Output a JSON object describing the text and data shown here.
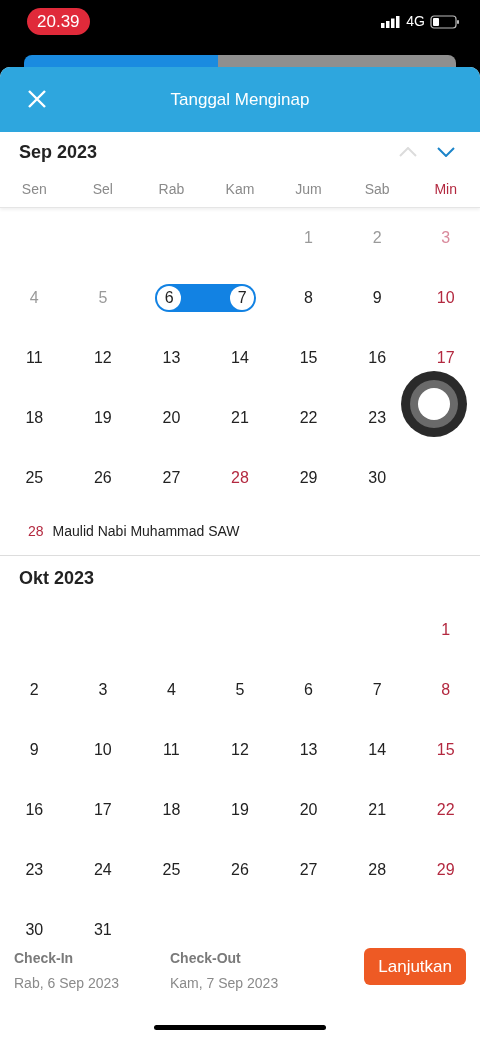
{
  "status_bar": {
    "time": "20.39",
    "network": "4G"
  },
  "header": {
    "title": "Tanggal Menginap"
  },
  "nav": {
    "prev_disabled": true,
    "next_disabled": false
  },
  "weekdays": [
    {
      "label": "Sen",
      "kind": "normal"
    },
    {
      "label": "Sel",
      "kind": "normal"
    },
    {
      "label": "Rab",
      "kind": "normal"
    },
    {
      "label": "Kam",
      "kind": "normal"
    },
    {
      "label": "Jum",
      "kind": "normal"
    },
    {
      "label": "Sab",
      "kind": "normal"
    },
    {
      "label": "Min",
      "kind": "sunday"
    }
  ],
  "months": [
    {
      "title": "Sep 2023",
      "weeks": [
        [
          {
            "kind": "blank"
          },
          {
            "kind": "blank"
          },
          {
            "kind": "blank"
          },
          {
            "kind": "blank"
          },
          {
            "day": "1",
            "kind": "past",
            "selected": false
          },
          {
            "day": "2",
            "kind": "past",
            "selected": false
          },
          {
            "day": "3",
            "kind": "past_holiday",
            "selected": false
          }
        ],
        [
          {
            "day": "4",
            "kind": "past",
            "selected": false
          },
          {
            "day": "5",
            "kind": "past",
            "selected": false
          },
          {
            "day": "6",
            "kind": "normal",
            "selected": true
          },
          {
            "day": "7",
            "kind": "normal",
            "selected": true
          },
          {
            "day": "8",
            "kind": "normal",
            "selected": false
          },
          {
            "day": "9",
            "kind": "normal",
            "selected": false
          },
          {
            "day": "10",
            "kind": "holiday",
            "selected": false
          }
        ],
        [
          {
            "day": "11",
            "kind": "normal",
            "selected": false
          },
          {
            "day": "12",
            "kind": "normal",
            "selected": false
          },
          {
            "day": "13",
            "kind": "normal",
            "selected": false
          },
          {
            "day": "14",
            "kind": "normal",
            "selected": false
          },
          {
            "day": "15",
            "kind": "normal",
            "selected": false
          },
          {
            "day": "16",
            "kind": "normal",
            "selected": false
          },
          {
            "day": "17",
            "kind": "holiday",
            "selected": false
          }
        ],
        [
          {
            "day": "18",
            "kind": "normal",
            "selected": false
          },
          {
            "day": "19",
            "kind": "normal",
            "selected": false
          },
          {
            "day": "20",
            "kind": "normal",
            "selected": false
          },
          {
            "day": "21",
            "kind": "normal",
            "selected": false
          },
          {
            "day": "22",
            "kind": "normal",
            "selected": false
          },
          {
            "day": "23",
            "kind": "normal",
            "selected": false
          },
          {
            "kind": "blank"
          }
        ],
        [
          {
            "day": "25",
            "kind": "normal",
            "selected": false
          },
          {
            "day": "26",
            "kind": "normal",
            "selected": false
          },
          {
            "day": "27",
            "kind": "normal",
            "selected": false
          },
          {
            "day": "28",
            "kind": "holiday",
            "selected": false
          },
          {
            "day": "29",
            "kind": "normal",
            "selected": false
          },
          {
            "day": "30",
            "kind": "normal",
            "selected": false
          },
          {
            "kind": "blank"
          }
        ]
      ],
      "holidays": [
        {
          "day": "28",
          "name": "Maulid Nabi Muhammad SAW"
        }
      ]
    },
    {
      "title": "Okt 2023",
      "weeks": [
        [
          {
            "kind": "blank"
          },
          {
            "kind": "blank"
          },
          {
            "kind": "blank"
          },
          {
            "kind": "blank"
          },
          {
            "kind": "blank"
          },
          {
            "kind": "blank"
          },
          {
            "day": "1",
            "kind": "holiday",
            "selected": false
          }
        ],
        [
          {
            "day": "2",
            "kind": "normal",
            "selected": false
          },
          {
            "day": "3",
            "kind": "normal",
            "selected": false
          },
          {
            "day": "4",
            "kind": "normal",
            "selected": false
          },
          {
            "day": "5",
            "kind": "normal",
            "selected": false
          },
          {
            "day": "6",
            "kind": "normal",
            "selected": false
          },
          {
            "day": "7",
            "kind": "normal",
            "selected": false
          },
          {
            "day": "8",
            "kind": "holiday",
            "selected": false
          }
        ],
        [
          {
            "day": "9",
            "kind": "normal",
            "selected": false
          },
          {
            "day": "10",
            "kind": "normal",
            "selected": false
          },
          {
            "day": "11",
            "kind": "normal",
            "selected": false
          },
          {
            "day": "12",
            "kind": "normal",
            "selected": false
          },
          {
            "day": "13",
            "kind": "normal",
            "selected": false
          },
          {
            "day": "14",
            "kind": "normal",
            "selected": false
          },
          {
            "day": "15",
            "kind": "holiday",
            "selected": false
          }
        ],
        [
          {
            "day": "16",
            "kind": "normal",
            "selected": false
          },
          {
            "day": "17",
            "kind": "normal",
            "selected": false
          },
          {
            "day": "18",
            "kind": "normal",
            "selected": false
          },
          {
            "day": "19",
            "kind": "normal",
            "selected": false
          },
          {
            "day": "20",
            "kind": "normal",
            "selected": false
          },
          {
            "day": "21",
            "kind": "normal",
            "selected": false
          },
          {
            "day": "22",
            "kind": "holiday",
            "selected": false
          }
        ],
        [
          {
            "day": "23",
            "kind": "normal",
            "selected": false
          },
          {
            "day": "24",
            "kind": "normal",
            "selected": false
          },
          {
            "day": "25",
            "kind": "normal",
            "selected": false
          },
          {
            "day": "26",
            "kind": "normal",
            "selected": false
          },
          {
            "day": "27",
            "kind": "normal",
            "selected": false
          },
          {
            "day": "28",
            "kind": "normal",
            "selected": false
          },
          {
            "day": "29",
            "kind": "holiday",
            "selected": false
          }
        ],
        [
          {
            "day": "30",
            "kind": "normal",
            "selected": false
          },
          {
            "day": "31",
            "kind": "normal",
            "selected": false
          },
          {
            "kind": "blank"
          },
          {
            "kind": "blank"
          },
          {
            "kind": "blank"
          },
          {
            "kind": "blank"
          },
          {
            "kind": "blank"
          }
        ]
      ]
    }
  ],
  "footer": {
    "check_in": {
      "label": "Check-In",
      "value": "Rab, 6 Sep 2023"
    },
    "check_out": {
      "label": "Check-Out",
      "value": "Kam, 7 Sep 2023"
    },
    "button": "Lanjutkan"
  }
}
